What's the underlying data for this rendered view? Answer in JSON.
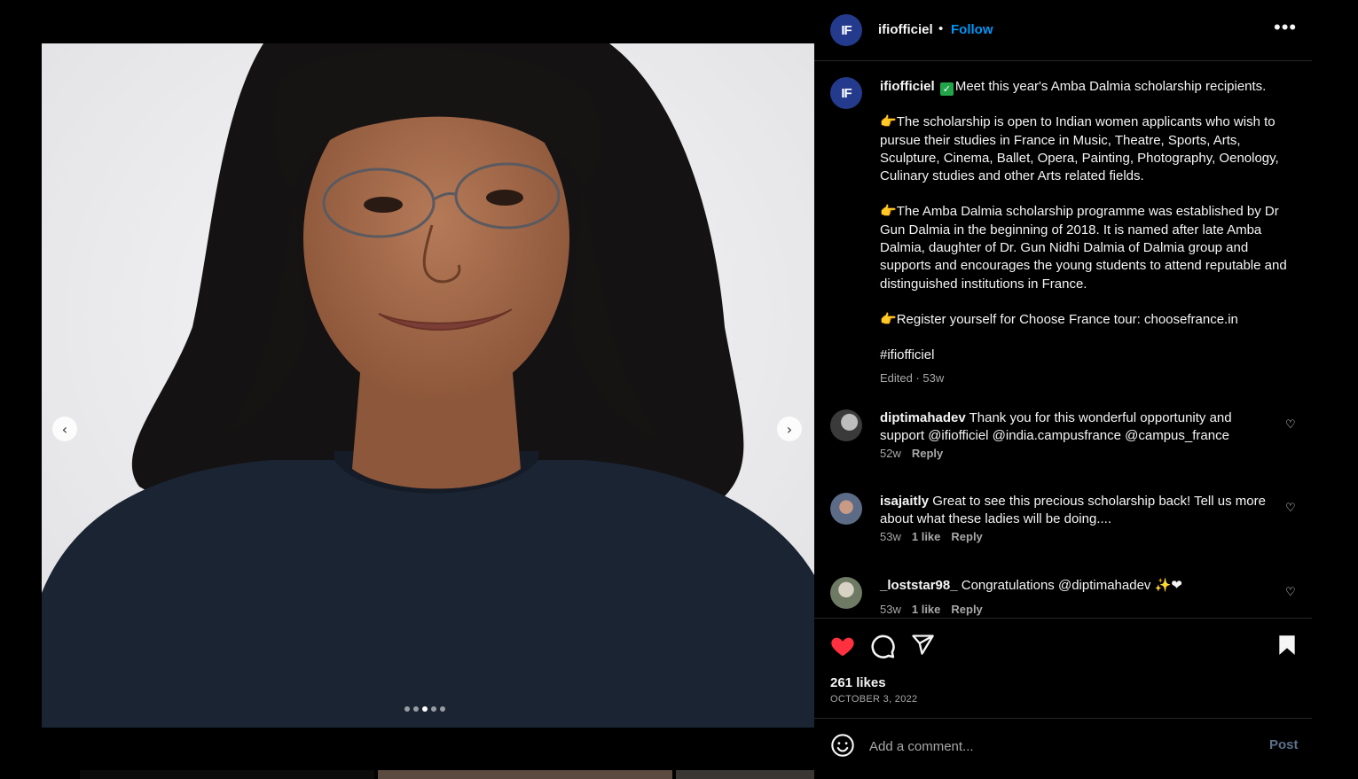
{
  "post": {
    "username": "ifiofficiel",
    "avatar_initials": "IF",
    "follow_label": "Follow",
    "separator": "•",
    "more_icon": "more-horizontal-icon",
    "carousel": {
      "total": 5,
      "active_index": 2
    }
  },
  "caption": {
    "username": "ifiofficiel",
    "verified_emoji": "✓",
    "intro": "Meet this year's Amba Dalmia scholarship recipients.",
    "point_emoji": "👉",
    "para1": "The scholarship is open to Indian women applicants who wish to pursue their studies in France in Music, Theatre, Sports, Arts, Sculpture, Cinema, Ballet, Opera, Painting, Photography, Oenology, Culinary studies and other Arts related fields.",
    "para2": "The Amba Dalmia scholarship programme was established by Dr Gun Dalmia in the beginning of 2018. It is named after late Amba Dalmia, daughter of Dr. Gun Nidhi Dalmia of Dalmia group and supports and encourages the young students to attend reputable and distinguished institutions in France.",
    "para3": "Register yourself for Choose France tour: choosefrance.in",
    "hashtag": "#ifiofficiel",
    "edited": "Edited · 53w"
  },
  "comments": [
    {
      "username": "diptimahadev",
      "text": "Thank you for this wonderful opportunity and support @ifiofficiel @india.campusfrance @campus_france",
      "time": "52w",
      "likes": "",
      "reply": "Reply"
    },
    {
      "username": "isajaitly",
      "text": "Great to see this precious scholarship back! Tell us more about what these ladies will be doing....",
      "time": "53w",
      "likes": "1 like",
      "reply": "Reply"
    },
    {
      "username": "_loststar98_",
      "text": "Congratulations @diptimahadev ✨❤",
      "time": "53w",
      "likes": "1 like",
      "reply": "Reply"
    }
  ],
  "stats": {
    "likes": "261 likes",
    "date": "OCTOBER 3, 2022"
  },
  "composer": {
    "placeholder": "Add a comment...",
    "post_label": "Post"
  },
  "colors": {
    "accent": "#0095f6",
    "heart": "#ff3040",
    "avatar_bg": "#243a8c"
  }
}
